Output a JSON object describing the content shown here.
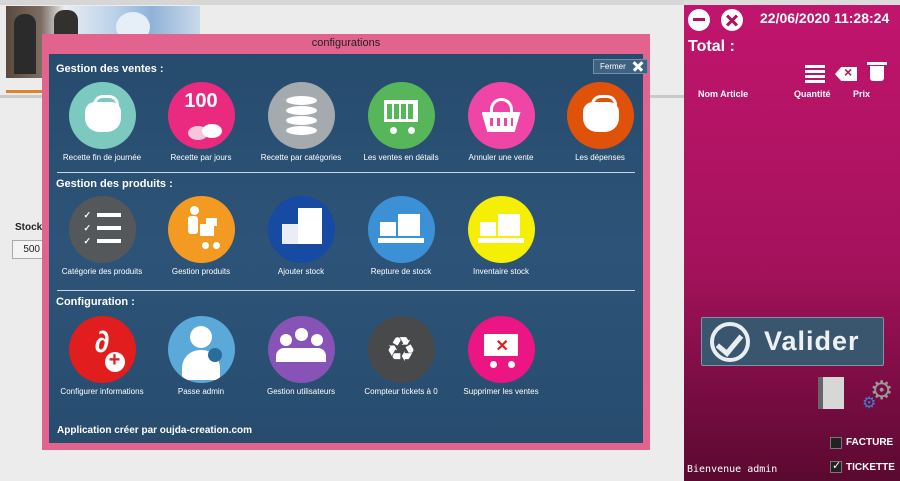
{
  "background": {
    "stock_label": "Stock",
    "stock_value": "500"
  },
  "right_panel": {
    "datetime": "22/06/2020 11:28:24",
    "total_label": "Total :",
    "columns": {
      "name": "Nom Article",
      "quantity": "Quantité",
      "price": "Prix"
    },
    "valider_label": "Valider",
    "facture_label": "FACTURE",
    "facture_checked": false,
    "tickette_label": "TICKETTE",
    "tickette_checked": true,
    "welcome": "Bienvenue admin"
  },
  "modal": {
    "title": "configurations",
    "close_label": "Fermer",
    "sections": [
      {
        "title": "Gestion des ventes :",
        "items": [
          {
            "label": "Recette fin de journée",
            "icon": "purse-icon",
            "color": "#7cc9c0"
          },
          {
            "label": "Recette par jours",
            "icon": "money-icon",
            "color": "#ea2a7e",
            "glyph_text": "100"
          },
          {
            "label": "Recette par catégories",
            "icon": "database-icon",
            "color": "#a4aaad"
          },
          {
            "label": "Les ventes en détails",
            "icon": "cart-icon",
            "color": "#56b659"
          },
          {
            "label": "Annuler une vente",
            "icon": "basket-icon",
            "color": "#ee45a6"
          },
          {
            "label": "Les dépenses",
            "icon": "purse-icon",
            "color": "#e0520a"
          }
        ]
      },
      {
        "title": "Gestion des produits :",
        "items": [
          {
            "label": "Catégorie des produits",
            "icon": "checklist-icon",
            "color": "#55585b"
          },
          {
            "label": "Gestion produits",
            "icon": "hand-truck-icon",
            "color": "#f39a22"
          },
          {
            "label": "Ajouter stock",
            "icon": "boxes-icon",
            "color": "#164aa3"
          },
          {
            "label": "Repture de stock",
            "icon": "pallet-icon",
            "color": "#3c91d6"
          },
          {
            "label": "Inventaire stock",
            "icon": "pallet-icon",
            "color": "#f5ef05"
          }
        ]
      },
      {
        "title": "Configuration :",
        "items": [
          {
            "label": "Configurer informations",
            "icon": "paperclip-add-icon",
            "color": "#e11d1d"
          },
          {
            "label": "Passe admin",
            "icon": "user-key-icon",
            "color": "#5aa9d8"
          },
          {
            "label": "Gestion utilisateurs",
            "icon": "users-key-icon",
            "color": "#8853b7"
          },
          {
            "label": "Compteur tickets à 0",
            "icon": "recycle-icon",
            "color": "#48494a"
          },
          {
            "label": "Supprimer les ventes",
            "icon": "cart-delete-icon",
            "color": "#eb1583"
          }
        ]
      }
    ],
    "footer": "Application créer par oujda-creation.com"
  }
}
